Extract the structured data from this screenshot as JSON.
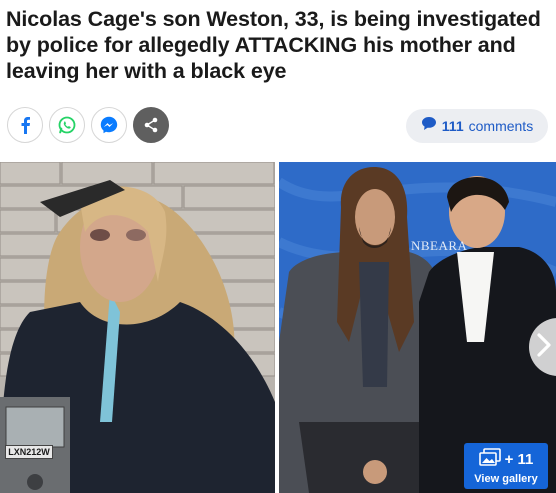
{
  "article": {
    "headline": "Nicolas Cage's son Weston, 33, is being investigated by police for allegedly ATTACKING his mother and leaving her with a black eye"
  },
  "share": {
    "buttons": [
      {
        "icon": "facebook-icon",
        "color": "#1877f2"
      },
      {
        "icon": "whatsapp-icon",
        "color": "#25d366"
      },
      {
        "icon": "messenger-icon",
        "color": "#0084ff"
      },
      {
        "icon": "share-icon",
        "color": "#ffffff"
      }
    ]
  },
  "comments": {
    "count": "111",
    "label": "comments"
  },
  "images": {
    "left": {
      "meter_plate": "LXN212W"
    },
    "right": {
      "backdrop_text": "NBEARA"
    }
  },
  "gallery": {
    "count": "+ 11",
    "label": "View gallery"
  },
  "colors": {
    "accent_blue": "#1565d8",
    "link_blue": "#1e5bc6",
    "pill_bg": "#eceef2"
  }
}
